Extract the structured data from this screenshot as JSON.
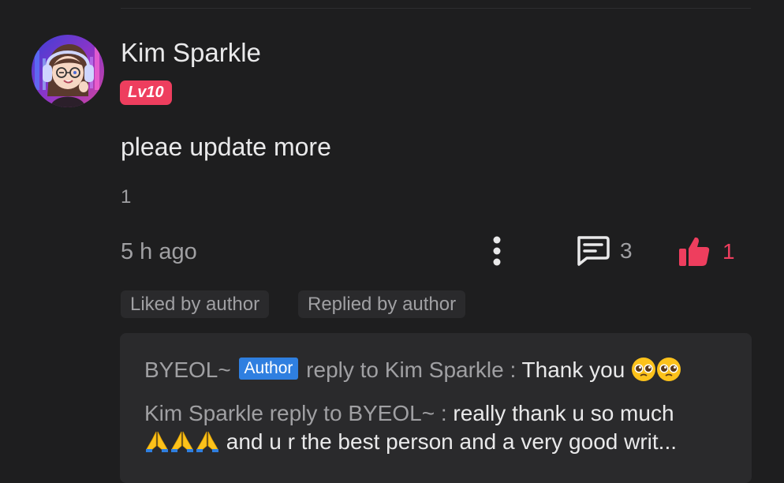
{
  "comment": {
    "username": "Kim Sparkle",
    "level_badge": "Lv10",
    "text": "pleae update more",
    "sub_number": "1",
    "timestamp": "5 h ago",
    "reply_count": "3",
    "like_count": "1"
  },
  "tags": {
    "liked": "Liked by author",
    "replied": "Replied by author"
  },
  "replies": [
    {
      "name": "BYEOL~",
      "badge": "Author",
      "reply_to": "reply to Kim Sparkle : ",
      "text": "Thank you",
      "emoji": [
        "pleading-face-icon",
        "pleading-face-icon"
      ]
    },
    {
      "name": "Kim Sparkle",
      "reply_to": " reply to BYEOL~ : ",
      "text_a": "really thank u so much",
      "emoji": [
        "folded-hands-icon",
        "folded-hands-icon",
        "folded-hands-icon"
      ],
      "text_b": " and u r the best person and a very good writ..."
    }
  ],
  "colors": {
    "background": "#1e1e1f",
    "accent_pink": "#ee3e5e",
    "author_blue": "#2f7fe0",
    "panel": "#2a2a2c",
    "text_primary": "#e9e9ea",
    "text_secondary": "#a0a0a3"
  }
}
